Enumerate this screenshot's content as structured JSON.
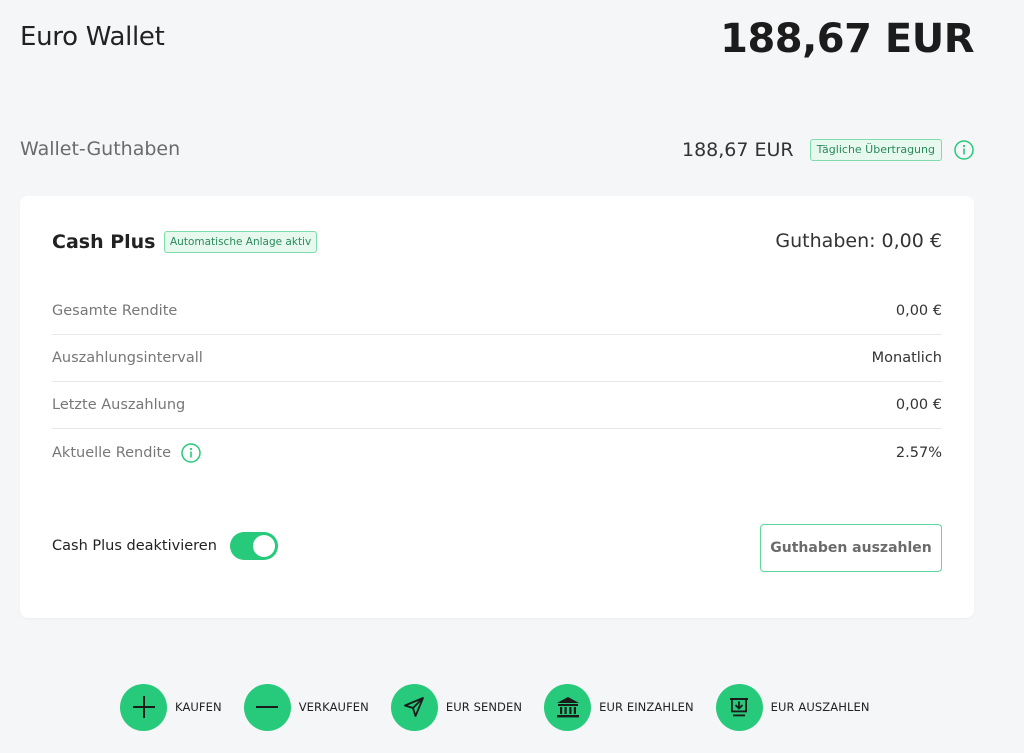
{
  "header": {
    "title": "Euro Wallet",
    "total": "188,67 EUR"
  },
  "balance": {
    "label": "Wallet-Guthaben",
    "amount": "188,67 EUR",
    "badge": "Tägliche Übertragung",
    "info_icon": "info-icon"
  },
  "card": {
    "title": "Cash Plus",
    "badge": "Automatische Anlage aktiv",
    "guthaben": "Guthaben: 0,00 €",
    "rows": [
      {
        "label": "Gesamte Rendite",
        "value": "0,00 €"
      },
      {
        "label": "Auszahlungsintervall",
        "value": "Monatlich"
      },
      {
        "label": "Letzte Auszahlung",
        "value": "0,00 €"
      },
      {
        "label": "Aktuelle Rendite",
        "value": "2.57%"
      }
    ],
    "toggle_label": "Cash Plus deaktivieren",
    "toggle_on": true,
    "payout_button": "Guthaben auszahlen"
  },
  "actions": [
    {
      "label": "KAUFEN",
      "icon": "plus-icon"
    },
    {
      "label": "VERKAUFEN",
      "icon": "minus-icon"
    },
    {
      "label": "EUR SENDEN",
      "icon": "send-icon"
    },
    {
      "label": "EUR EINZAHLEN",
      "icon": "bank-icon"
    },
    {
      "label": "EUR AUSZAHLEN",
      "icon": "withdraw-icon"
    }
  ],
  "colors": {
    "accent": "#27c97a",
    "badge_bg": "#e7f9ef",
    "badge_border": "#7fdcab",
    "background": "#f5f6f8"
  }
}
